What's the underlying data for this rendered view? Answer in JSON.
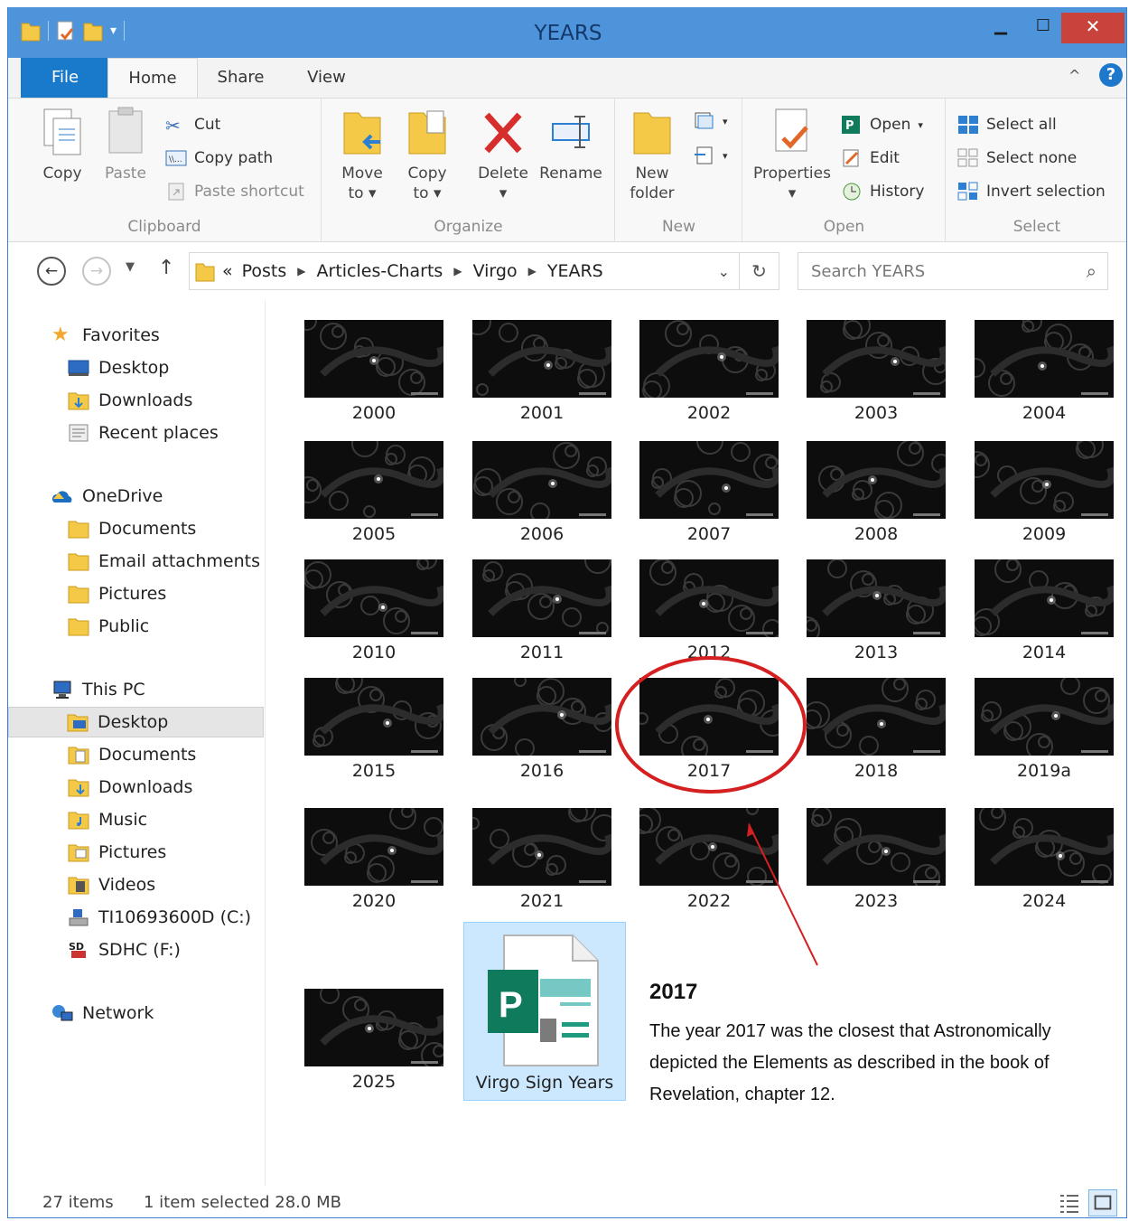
{
  "window": {
    "title": "YEARS"
  },
  "tabs": {
    "file": "File",
    "home": "Home",
    "share": "Share",
    "view": "View"
  },
  "ribbon": {
    "clipboard": {
      "label": "Clipboard",
      "copy": "Copy",
      "paste": "Paste",
      "cut": "Cut",
      "copy_path": "Copy path",
      "paste_shortcut": "Paste shortcut"
    },
    "organize": {
      "label": "Organize",
      "move_to_1": "Move",
      "move_to_2": "to",
      "copy_to_1": "Copy",
      "copy_to_2": "to",
      "delete": "Delete",
      "rename": "Rename"
    },
    "new": {
      "label": "New",
      "new_folder_1": "New",
      "new_folder_2": "folder"
    },
    "open": {
      "label": "Open",
      "properties": "Properties",
      "open": "Open",
      "edit": "Edit",
      "history": "History"
    },
    "select": {
      "label": "Select",
      "select_all": "Select all",
      "select_none": "Select none",
      "invert": "Invert selection"
    }
  },
  "address": {
    "crumbs": [
      "Posts",
      "Articles-Charts",
      "Virgo",
      "YEARS"
    ],
    "overflow": "«",
    "search_placeholder": "Search YEARS"
  },
  "nav": {
    "favorites": "Favorites",
    "fav_desktop": "Desktop",
    "fav_downloads": "Downloads",
    "fav_recent": "Recent places",
    "onedrive": "OneDrive",
    "od_documents": "Documents",
    "od_email": "Email attachments",
    "od_pictures": "Pictures",
    "od_public": "Public",
    "thispc": "This PC",
    "pc_desktop": "Desktop",
    "pc_documents": "Documents",
    "pc_downloads": "Downloads",
    "pc_music": "Music",
    "pc_pictures": "Pictures",
    "pc_videos": "Videos",
    "pc_c": "TI10693600D (C:)",
    "pc_f": "SDHC (F:)",
    "network": "Network"
  },
  "files": [
    "2000",
    "2001",
    "2002",
    "2003",
    "2004",
    "2005",
    "2006",
    "2007",
    "2008",
    "2009",
    "2010",
    "2011",
    "2012",
    "2013",
    "2014",
    "2015",
    "2016",
    "2017",
    "2018",
    "2019a",
    "2020",
    "2021",
    "2022",
    "2023",
    "2024",
    "2025"
  ],
  "selected_file": "Virgo Sign Years",
  "annotation": {
    "title": "2017",
    "text": "The year 2017 was the closest that Astronomically depicted the Elements as described in the book of Revelation, chapter 12."
  },
  "status": {
    "count": "27 items",
    "selection": "1 item selected  28.0 MB"
  },
  "colors": {
    "titlebar": "#4d94db",
    "file_tab": "#1979ca",
    "close": "#c7433b",
    "annotation": "#d42020",
    "selection": "#cce8ff"
  }
}
